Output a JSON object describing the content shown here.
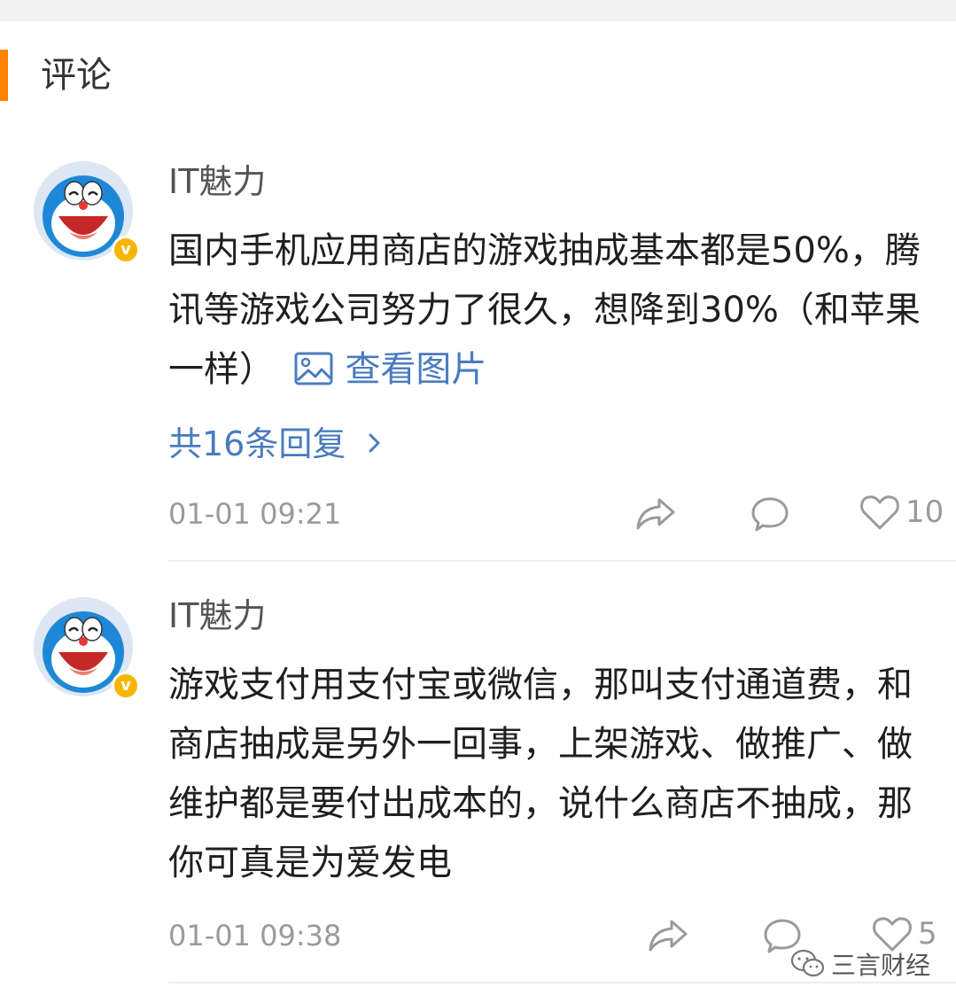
{
  "section": {
    "title": "评论"
  },
  "comments": [
    {
      "username": "IT魅力",
      "text": "国内手机应用商店的游戏抽成基本都是50%，腾讯等游戏公司努力了很久，想降到30%（和苹果一样）",
      "view_pic_label": "查看图片",
      "replies_label": "共16条回复",
      "timestamp": "01-01 09:21",
      "likes": "10"
    },
    {
      "username": "IT魅力",
      "text": "游戏支付用支付宝或微信，那叫支付通道费，和商店抽成是另外一回事，上架游戏、做推广、做维护都是要付出成本的，说什么商店不抽成，那你可真是为爱发电",
      "timestamp": "01-01 09:38",
      "likes": "5"
    }
  ],
  "watermark": {
    "text": "三言财经"
  },
  "colors": {
    "accent": "#ff8200",
    "link": "#4a7bbf",
    "badge": "#f7b500"
  }
}
